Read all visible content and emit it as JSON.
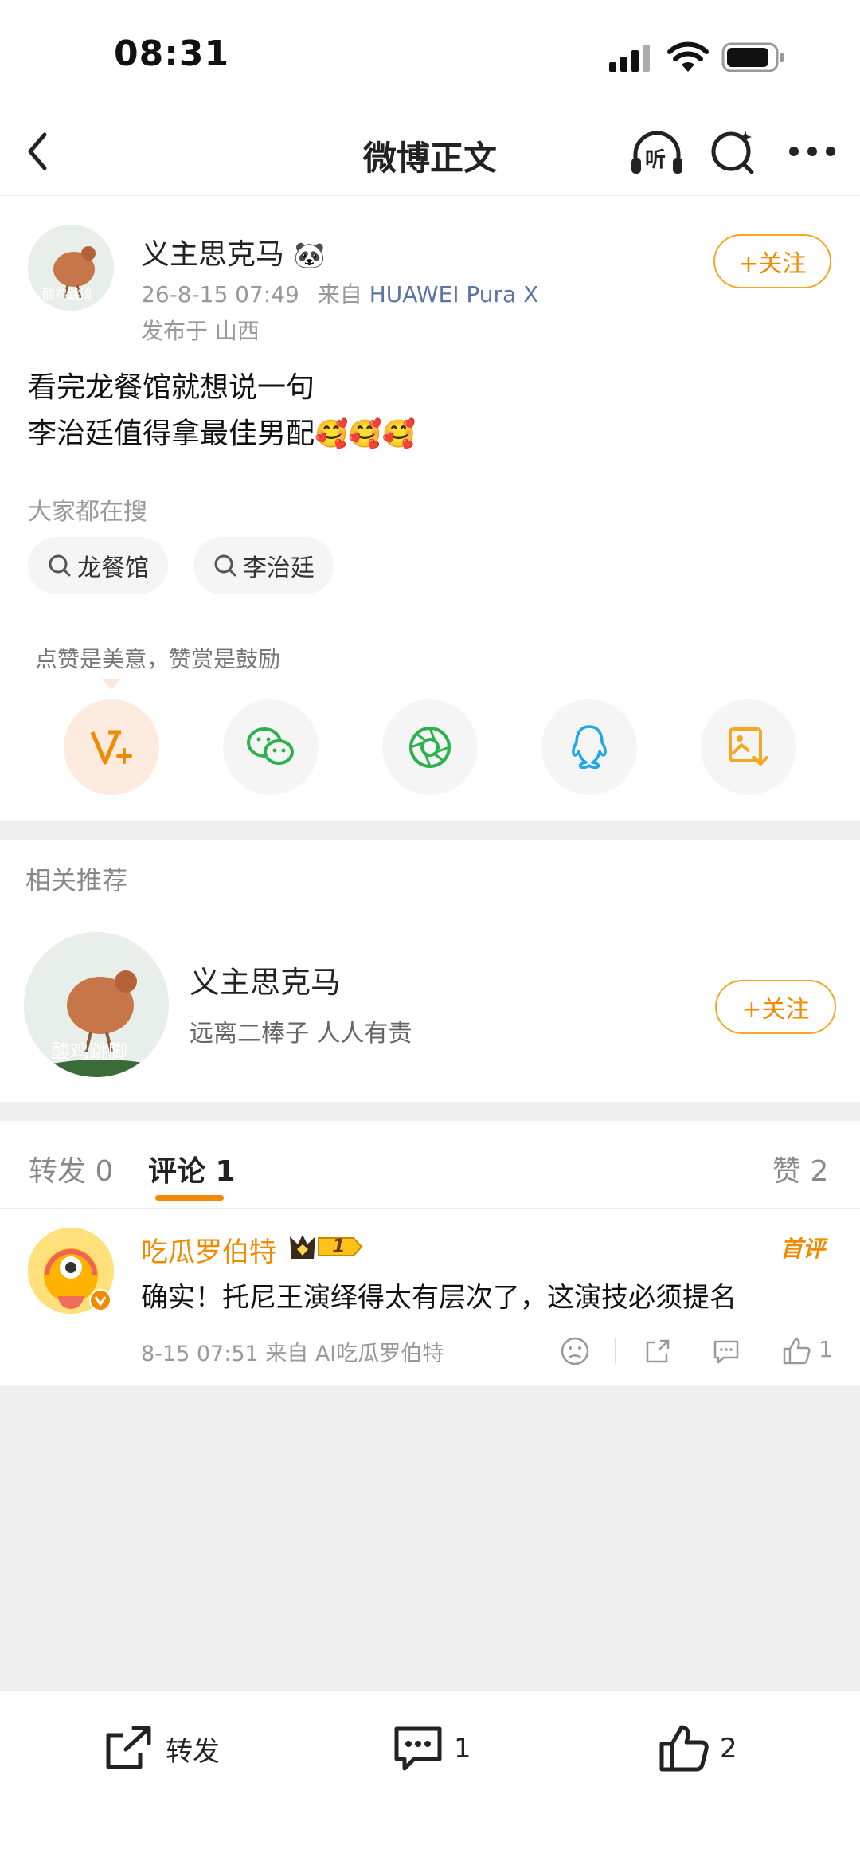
{
  "status": {
    "time": "08:31"
  },
  "nav": {
    "title": "微博正文",
    "listen_label": "听"
  },
  "post": {
    "author": "义主思克马",
    "author_emoji": "🐼",
    "time": "26-8-15 07:49",
    "source_prefix": "来自",
    "source_device": "HUAWEI Pura X",
    "location_prefix": "发布于",
    "location": "山西",
    "follow_label": "+关注",
    "text_line1": "看完龙餐馆就想说一句",
    "text_line2": "李治廷值得拿最佳男配",
    "text_emojis": "🥰🥰🥰",
    "avatar_text": "酸鸡跳脚"
  },
  "search": {
    "title": "大家都在搜",
    "chips": [
      "龙餐馆",
      "李治廷"
    ]
  },
  "reward": {
    "hint": "点赞是美意，赞赏是鼓励"
  },
  "share_icons": [
    "reward-v-icon",
    "wechat-icon",
    "moments-icon",
    "qq-icon",
    "save-image-icon"
  ],
  "recommend": {
    "title": "相关推荐",
    "name": "义主思克马",
    "bio": "远离二棒子 人人有责",
    "avatar_text": "酸鸡跳脚",
    "follow_label": "+关注"
  },
  "tabs": {
    "repost": "转发 0",
    "comment": "评论 1",
    "like": "赞 2"
  },
  "comment": {
    "user": "吃瓜罗伯特",
    "badge_level": "1",
    "hot_tag": "首评",
    "text": "确实！托尼王演绎得太有层次了，这演技必须提名",
    "meta": "8-15 07:51 来自 AI吃瓜罗伯特",
    "like_count": "1"
  },
  "bottombar": {
    "repost_label": "转发",
    "comment_count": "1",
    "like_count": "2"
  },
  "colors": {
    "accent": "#f08a00",
    "link": "#5a74a6",
    "separator": "#efefef"
  }
}
